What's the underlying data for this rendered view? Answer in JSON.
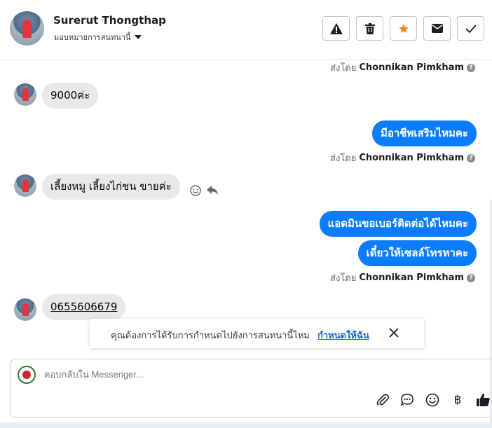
{
  "header": {
    "name": "Surerut Thongthap",
    "assign_label": "มอบหมายการสนทนานี้",
    "actions": [
      "report-icon",
      "trash-icon",
      "star-icon",
      "mail-icon",
      "check-icon"
    ],
    "star_color": "#f5811f"
  },
  "chat": {
    "sent_by_prefix": "ส่งโดย",
    "agent_name": "Chonnikan Pimkham",
    "messages": [
      {
        "dir": "in",
        "text": "9000ค่ะ"
      },
      {
        "dir": "out",
        "text": "มีอาชีพเสริมไหมคะ"
      },
      {
        "dir": "in",
        "text": "เลี้ยงหมู เลี้ยงไก่ชน ขายค่ะ"
      },
      {
        "dir": "out",
        "text": "แอดมินขอเบอร์ติดต่อได้ไหมคะ"
      },
      {
        "dir": "out",
        "text": "เดี๋ยวให้เซลล์โทรหาคะ"
      },
      {
        "dir": "in",
        "text": "0655606679"
      }
    ],
    "outgoing_color": "#0a7cff",
    "incoming_color": "#e9e9eb"
  },
  "banner": {
    "text": "คุณต้องการได้รับการกำหนดไปยังการสนทนานี้ไหม",
    "link": "กำหนดให้ฉัน"
  },
  "composer": {
    "placeholder": "ตอบกลับใน Messenger...",
    "tools": [
      "attachment-icon",
      "saved-reply-icon",
      "emoji-icon",
      "baht-icon",
      "like-icon"
    ]
  }
}
